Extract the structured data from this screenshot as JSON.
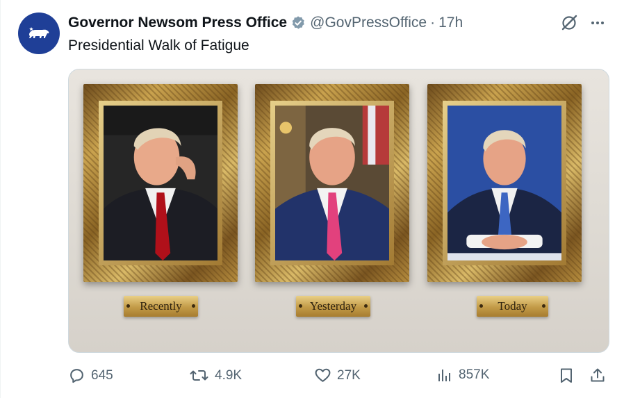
{
  "tweet": {
    "display_name": "Governor Newsom Press Office",
    "handle": "@GovPressOffice",
    "separator": "·",
    "time": "17h",
    "text": "Presidential Walk of Fatigue"
  },
  "media": {
    "plaques": [
      "Recently",
      "Yesterday",
      "Today"
    ]
  },
  "stats": {
    "replies": "645",
    "reposts": "4.9K",
    "likes": "27K",
    "views": "857K"
  },
  "icons": {
    "avatar": "california-bear-icon",
    "verified": "verified-badge-icon",
    "grok": "grok-icon",
    "more": "more-icon",
    "reply": "reply-icon",
    "repost": "repost-icon",
    "like": "heart-icon",
    "views": "views-icon",
    "bookmark": "bookmark-icon",
    "share": "share-icon"
  },
  "colors": {
    "avatar_bg": "#1f3f97",
    "verified": "#829aab",
    "text_secondary": "#536471"
  }
}
